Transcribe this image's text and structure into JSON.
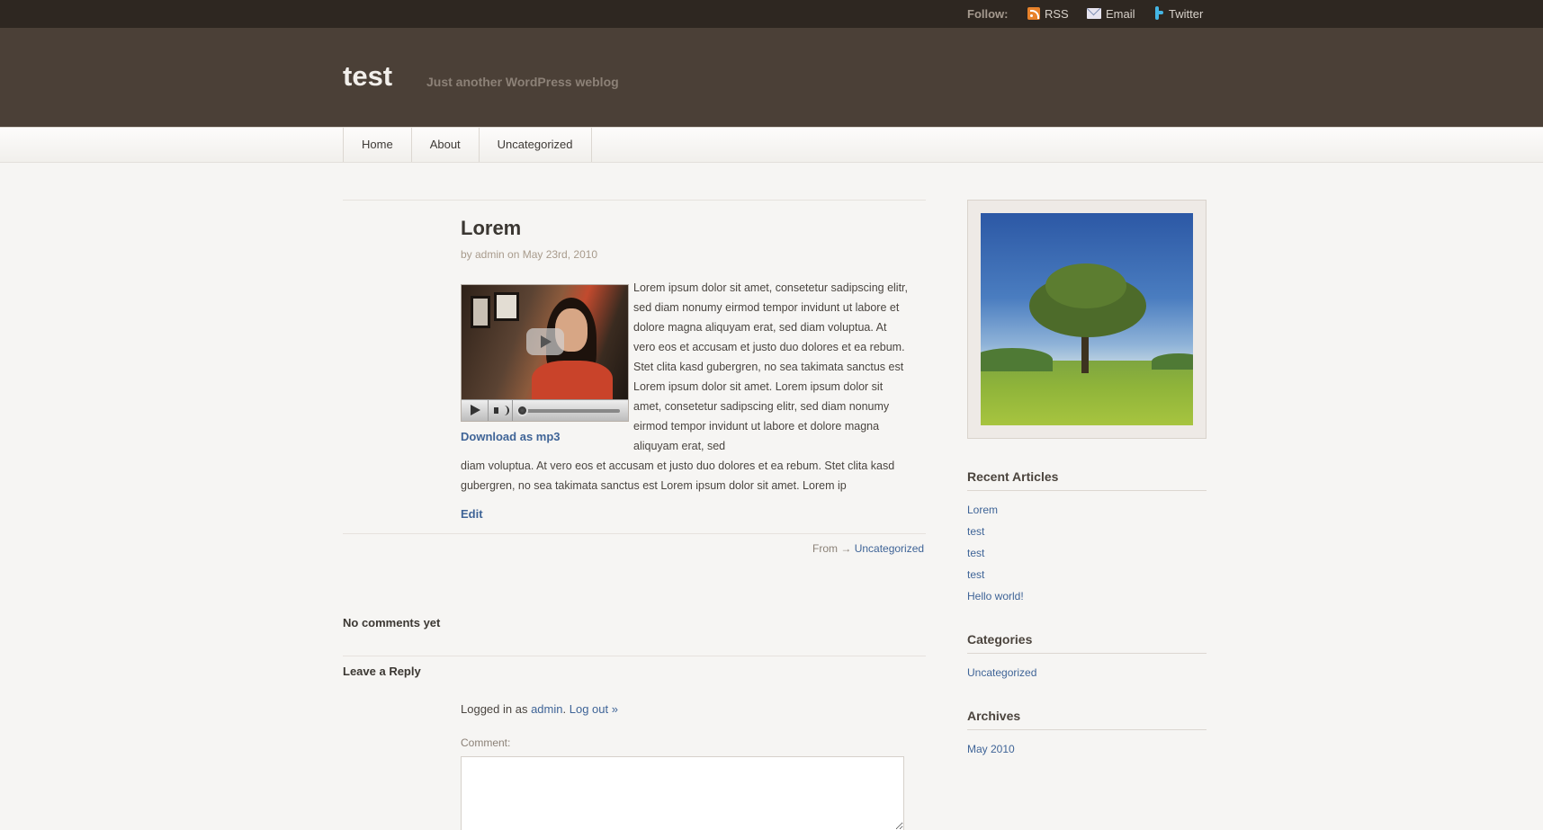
{
  "topbar": {
    "follow_label": "Follow:",
    "links": [
      {
        "label": "RSS",
        "icon": "rss-icon"
      },
      {
        "label": "Email",
        "icon": "email-icon"
      },
      {
        "label": "Twitter",
        "icon": "twitter-icon"
      }
    ]
  },
  "header": {
    "site_title": "test",
    "tagline": "Just another WordPress weblog"
  },
  "nav": {
    "items": [
      "Home",
      "About",
      "Uncategorized"
    ]
  },
  "post": {
    "title": "Lorem",
    "meta": "by admin on May 23rd, 2010",
    "download_label": "Download as mp3",
    "body_wrap": "Lorem ipsum dolor sit amet, consetetur sadipscing elitr, sed diam nonumy eirmod tempor invidunt ut labore et dolore magna aliquyam erat, sed diam voluptua. At vero eos et accusam et justo duo dolores et ea rebum. Stet clita kasd gubergren, no sea takimata sanctus est Lorem ipsum dolor sit amet. Lorem ipsum dolor sit amet, consetetur sadipscing elitr, sed diam nonumy eirmod tempor invidunt ut labore et dolore magna aliquyam erat, sed",
    "body_full": "diam voluptua. At vero eos et accusam et justo duo dolores et ea rebum. Stet clita kasd gubergren, no sea takimata sanctus est Lorem ipsum dolor sit amet. Lorem ip",
    "edit_label": "Edit",
    "from_label": "From →",
    "category": "Uncategorized"
  },
  "comments": {
    "count_label": "No comments yet",
    "leave_reply": "Leave a Reply",
    "logged_in_prefix": "Logged in as",
    "user": "admin",
    "logout": "Log out »",
    "comment_label": "Comment:"
  },
  "sidebar": {
    "recent_title": "Recent Articles",
    "recent": [
      "Lorem",
      "test",
      "test",
      "test",
      "Hello world!"
    ],
    "categories_title": "Categories",
    "categories": [
      "Uncategorized"
    ],
    "archives_title": "Archives",
    "archives": [
      "May 2010"
    ]
  }
}
